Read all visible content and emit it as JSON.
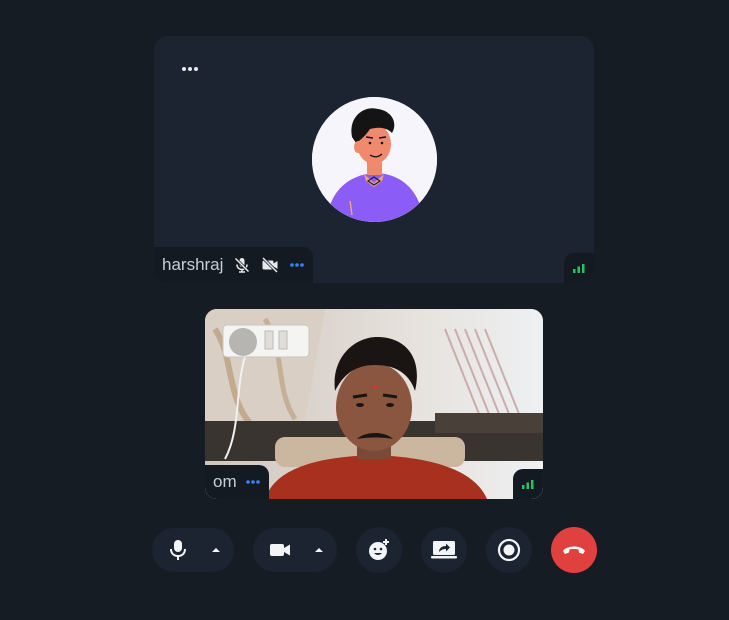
{
  "participants": {
    "remote": {
      "name": "harshraj",
      "mic_state": "muted",
      "camera_state": "off",
      "avatar_icon": "cartoon-avatar-icon",
      "menu_icon": "more-dots-icon",
      "signal_color": "#22c55e"
    },
    "local": {
      "name": "om",
      "video_state": "on",
      "menu_icon": "more-dots-icon",
      "signal_color": "#22c55e"
    }
  },
  "controls": {
    "mic": {
      "icon": "microphone-icon",
      "options_icon": "caret-up-icon"
    },
    "camera": {
      "icon": "video-camera-icon",
      "options_icon": "caret-up-icon"
    },
    "reactions": {
      "icon": "emoji-add-icon"
    },
    "screen_share": {
      "icon": "share-screen-icon"
    },
    "record": {
      "icon": "record-icon"
    },
    "leave": {
      "icon": "hang-up-icon",
      "color": "#e0413f"
    }
  },
  "colors": {
    "background": "#151c24",
    "tile": "#1b2430",
    "accent_blue": "#3b82f6",
    "avatar_shirt": "#8b5cf6"
  }
}
